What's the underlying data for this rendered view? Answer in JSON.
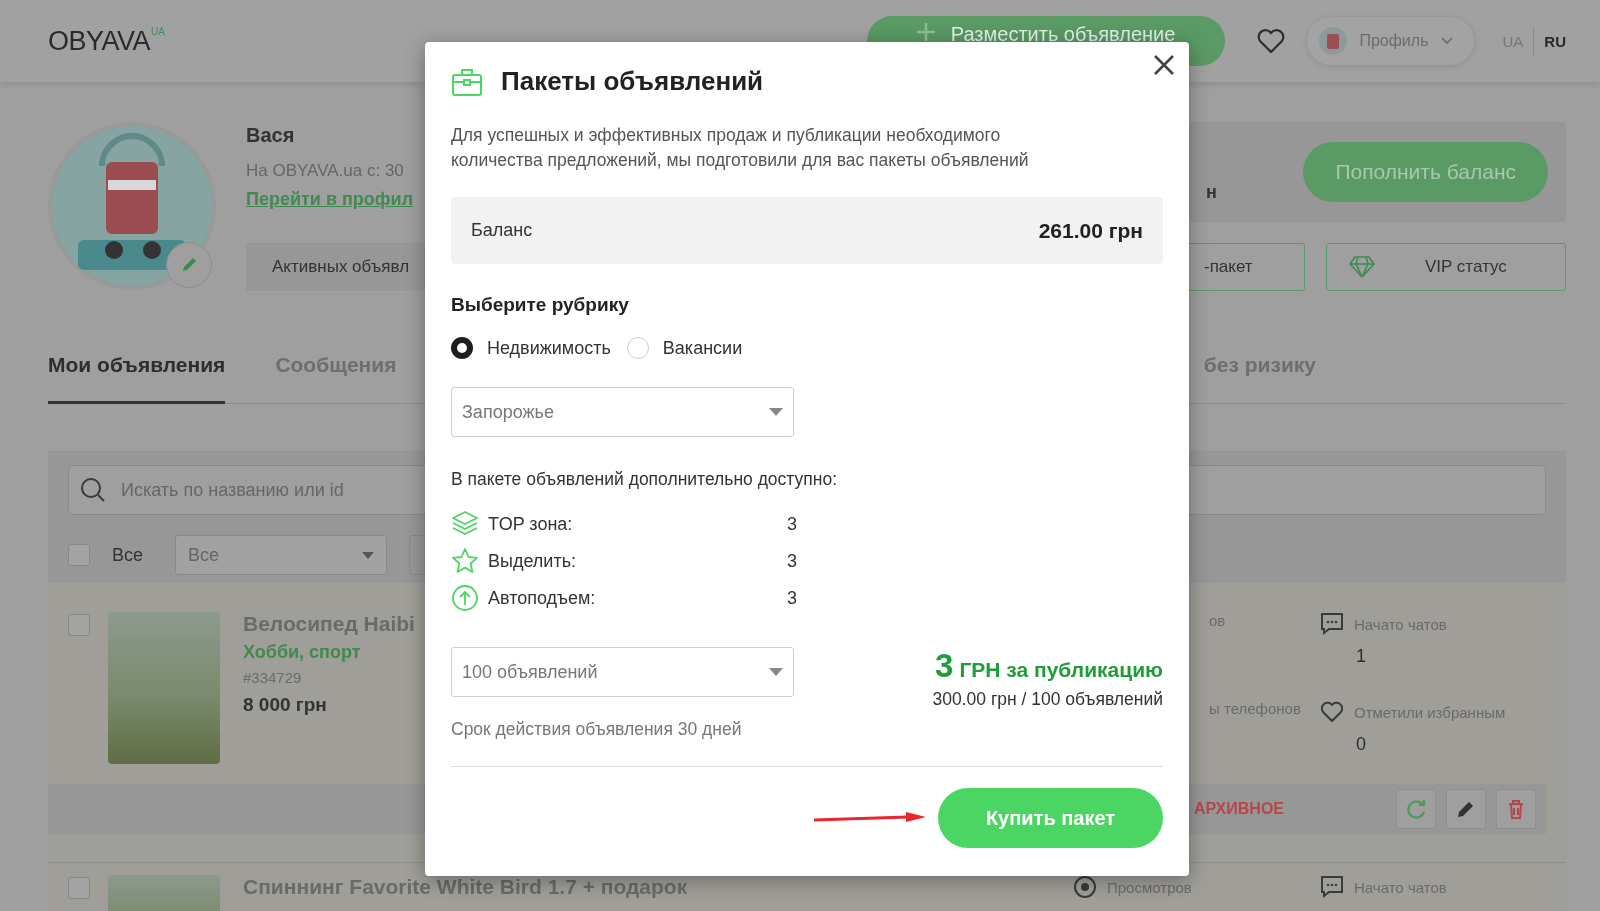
{
  "header": {
    "logo": "OBYAVA",
    "logo_sup": "UA",
    "post_button": "Разместить объявление",
    "profile_label": "Профиль",
    "languages": [
      {
        "label": "UA",
        "selected": false
      },
      {
        "label": "RU",
        "selected": true
      }
    ]
  },
  "profile": {
    "name": "Вася",
    "since": "На OBYAVA.ua с: 30",
    "profile_link": "Перейти в профил",
    "balance_fragment": "н",
    "topup_button": "Пополнить баланс",
    "active_ads_button": "Активных объявл",
    "package_button": "-пакет",
    "vip_button": "VIP статус"
  },
  "tabs": [
    {
      "label": "Мои объявления",
      "selected": true
    },
    {
      "label": "Сообщения",
      "selected": false
    },
    {
      "label": "без ризику",
      "selected": false
    }
  ],
  "filters": {
    "search_placeholder": "Искать по названию или id",
    "select_all_label": "Все",
    "select_all_checked": false,
    "status_select": "Все"
  },
  "listings": [
    {
      "title": "Велосипед Haibi",
      "category": "Хобби, спорт",
      "id": "#334729",
      "price": "8 000 грн",
      "checked": false,
      "status": "АРХИВНОЕ",
      "stats": [
        {
          "kind": "cut",
          "label": "ов"
        },
        {
          "kind": "chats",
          "label": "Начато чатов",
          "value": "1"
        },
        {
          "kind": "cut",
          "label": "ы телефонов"
        },
        {
          "kind": "favorites",
          "label": "Отметили избранным",
          "value": "0"
        }
      ]
    },
    {
      "title": "Спиннинг Favorite White Bird 1.7 + подарок",
      "checked": false,
      "stats": [
        {
          "kind": "views",
          "label": "Просмотров"
        },
        {
          "kind": "chats",
          "label": "Начато чатов"
        }
      ]
    }
  ],
  "modal": {
    "title": "Пакеты объявлений",
    "description": "Для успешных и эффективных продаж и публикации необходимого количества предложений, мы подготовили для вас пакеты объявлений",
    "balance": {
      "label": "Баланс",
      "amount": "261.00 грн"
    },
    "rubric_heading": "Выберите рубрику",
    "rubrics": [
      {
        "label": "Недвижимость",
        "selected": true
      },
      {
        "label": "Вакансии",
        "selected": false
      }
    ],
    "region_select": {
      "value": "Запорожье"
    },
    "extras_heading": "В пакете объявлений дополнительно доступно:",
    "extras": [
      {
        "kind": "top",
        "label": "TOP зона:",
        "value": "3"
      },
      {
        "kind": "highlight",
        "label": "Выделить:",
        "value": "3"
      },
      {
        "kind": "lift",
        "label": "Автоподъем:",
        "value": "3"
      }
    ],
    "count_select": {
      "value": "100 объявлений"
    },
    "price": {
      "amount": "3",
      "unit": "ГРН за публикацию",
      "detail": "300.00 грн / 100 объявлений"
    },
    "validity": "Срок действия объявления 30 дней",
    "buy_button": "Купить пакет"
  }
}
